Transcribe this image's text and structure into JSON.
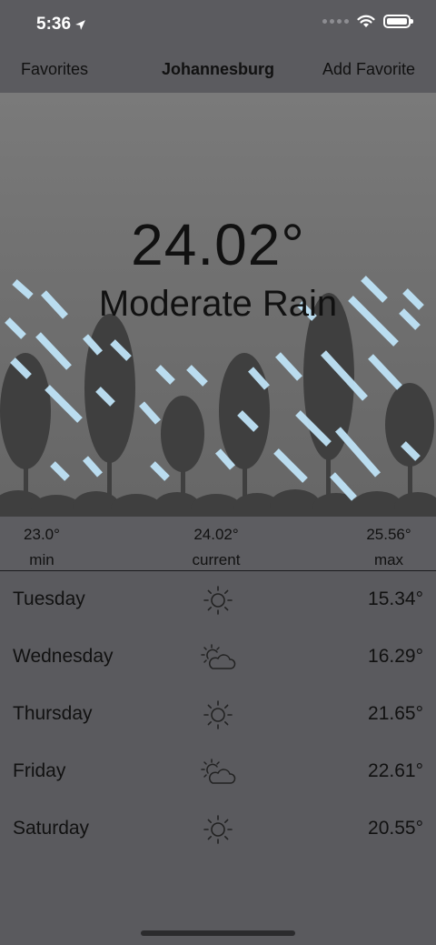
{
  "status": {
    "time": "5:36"
  },
  "nav": {
    "left": "Favorites",
    "title": "Johannesburg",
    "right": "Add Favorite"
  },
  "current": {
    "temp": "24.02°",
    "condition": "Moderate Rain"
  },
  "summary": {
    "min_value": "23.0°",
    "min_label": "min",
    "current_value": "24.02°",
    "current_label": "current",
    "max_value": "25.56°",
    "max_label": "max"
  },
  "forecast": [
    {
      "day": "Tuesday",
      "icon": "sun-icon",
      "temp": "15.34°"
    },
    {
      "day": "Wednesday",
      "icon": "partly-cloudy-icon",
      "temp": "16.29°"
    },
    {
      "day": "Thursday",
      "icon": "sun-icon",
      "temp": "21.65°"
    },
    {
      "day": "Friday",
      "icon": "partly-cloudy-icon",
      "temp": "22.61°"
    },
    {
      "day": "Saturday",
      "icon": "sun-icon",
      "temp": "20.55°"
    }
  ],
  "colors": {
    "rain": "#bfe3f7",
    "tree": "#3f3f3f",
    "background": "#5a5a5e"
  }
}
